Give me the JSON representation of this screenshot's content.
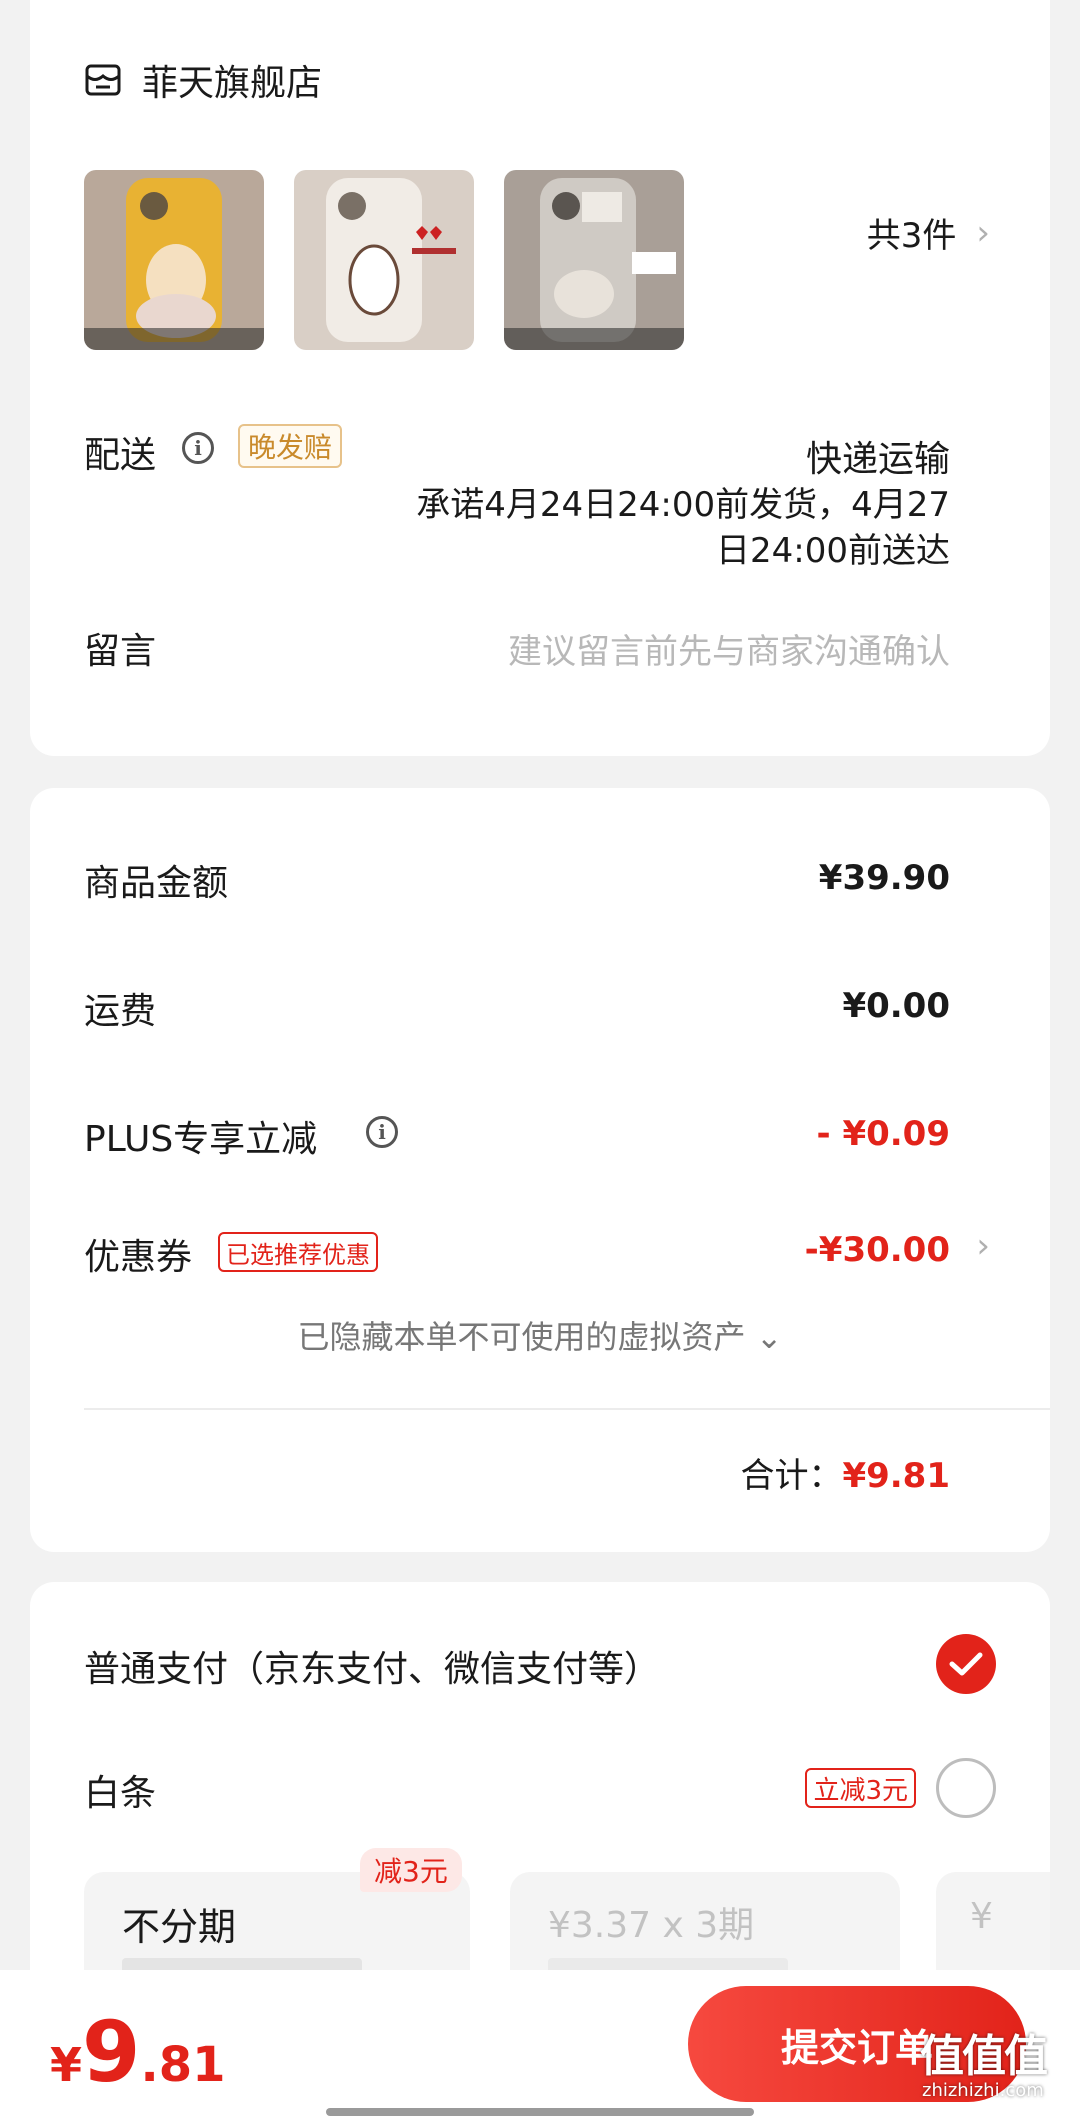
{
  "store": {
    "name": "菲天旗舰店",
    "item_count": "共3件",
    "icon": "store-icon",
    "products": [
      {
        "name": "product-thumb-1",
        "color": "#e8b233"
      },
      {
        "name": "product-thumb-2",
        "color": "#f1ece6"
      },
      {
        "name": "product-thumb-3",
        "color": "#cfcac4"
      }
    ]
  },
  "delivery": {
    "label": "配送",
    "tag": "晚发赔",
    "method": "快递运输",
    "promise_line1": "承诺4月24日24:00前发货，4月27",
    "promise_line2": "日24:00前送达"
  },
  "message": {
    "label": "留言",
    "placeholder": "建议留言前先与商家沟通确认"
  },
  "pricing": {
    "goods_label": "商品金额",
    "goods_value": "¥39.90",
    "shipping_label": "运费",
    "shipping_value": "¥0.00",
    "plus_label": "PLUS专享立减",
    "plus_value": "- ¥0.09",
    "coupon_label": "优惠券",
    "coupon_tag": "已选推荐优惠",
    "coupon_value": "-¥30.00",
    "hidden_assets": "已隐藏本单不可使用的虚拟资产",
    "total_label": "合计：",
    "total_value": "¥9.81"
  },
  "payment": {
    "normal_label": "普通支付（京东支付、微信支付等）",
    "baitiao_label": "白条",
    "baitiao_tag": "立减3元",
    "plan_badge": "减3元",
    "plan1_title": "不分期",
    "plan2_title": "¥3.37 x 3期",
    "plan3_title": "¥"
  },
  "bottom": {
    "yen": "¥",
    "int": "9",
    "dec": ".81",
    "submit": "提交订单"
  },
  "watermark": {
    "text": "值值值",
    "sub": "zhizhizhi.com"
  },
  "colors": {
    "accent": "#e2231a",
    "late_tag": "#c98a2b",
    "background": "#f2f2f2"
  }
}
